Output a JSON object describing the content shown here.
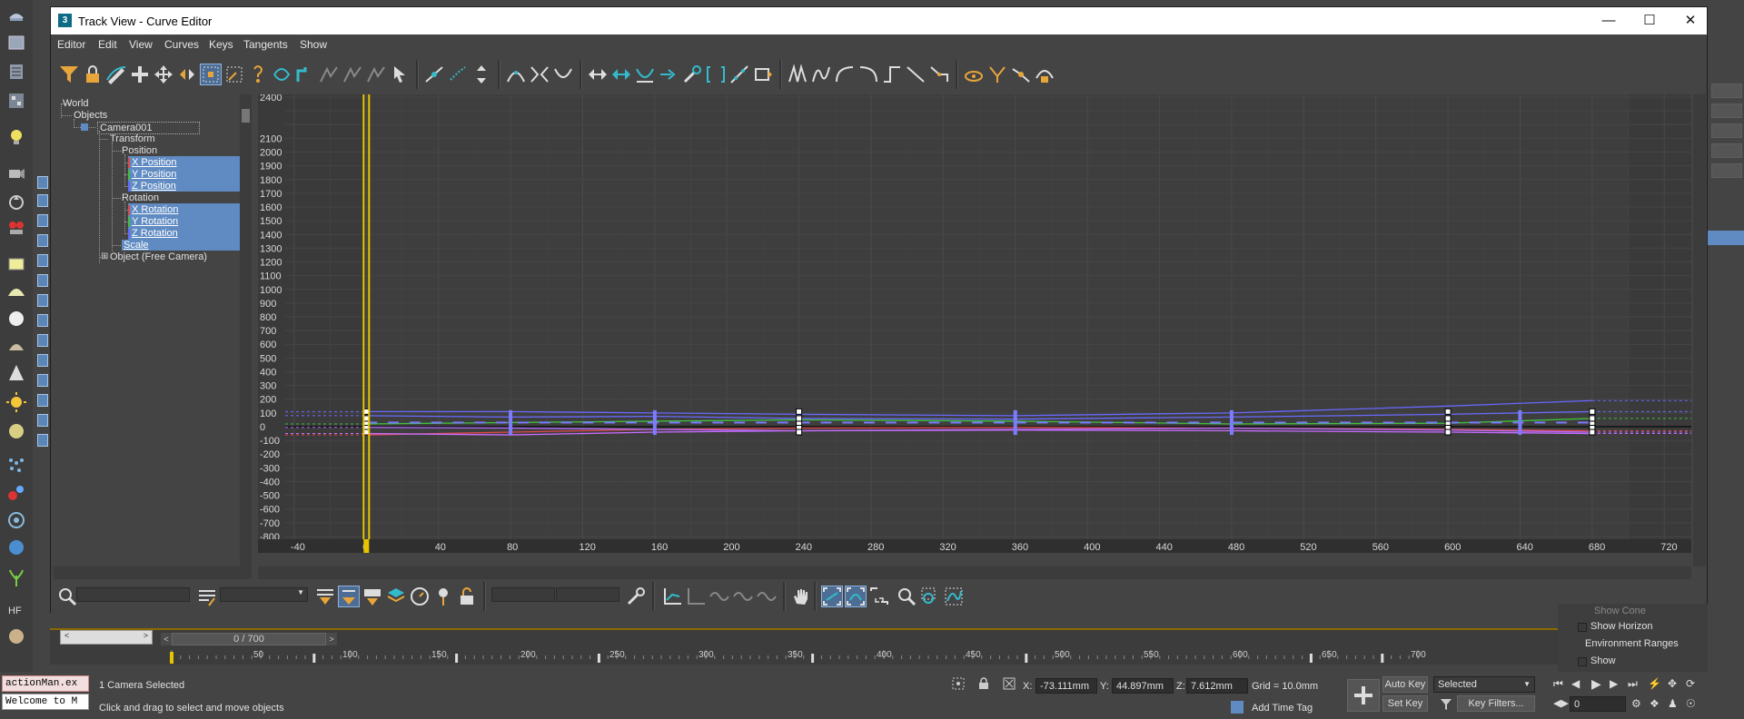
{
  "window": {
    "title": "Track View - Curve Editor",
    "app_icon": "3"
  },
  "menu": [
    "Editor",
    "Edit",
    "View",
    "Curves",
    "Keys",
    "Tangents",
    "Show"
  ],
  "tree": [
    {
      "label": "World",
      "x": 10,
      "y": 4,
      "sel": false
    },
    {
      "label": "Objects",
      "x": 22,
      "y": 17,
      "sel": false
    },
    {
      "label": "Camera001",
      "x": 48,
      "y": 30,
      "sel": false,
      "box": true
    },
    {
      "label": "Transform",
      "x": 62,
      "y": 43,
      "sel": false
    },
    {
      "label": "Position",
      "x": 75,
      "y": 56,
      "sel": false
    },
    {
      "label": "X Position",
      "x": 84,
      "y": 69,
      "sel": true
    },
    {
      "label": "Y Position",
      "x": 84,
      "y": 82,
      "sel": true
    },
    {
      "label": "Z Position",
      "x": 84,
      "y": 95,
      "sel": true
    },
    {
      "label": "Rotation",
      "x": 75,
      "y": 108,
      "sel": false
    },
    {
      "label": "X Rotation",
      "x": 84,
      "y": 121,
      "sel": true
    },
    {
      "label": "Y Rotation",
      "x": 84,
      "y": 134,
      "sel": true
    },
    {
      "label": "Z Rotation",
      "x": 84,
      "y": 147,
      "sel": true
    },
    {
      "label": "Scale",
      "x": 75,
      "y": 160,
      "sel": true
    },
    {
      "label": "Object (Free Camera)",
      "x": 62,
      "y": 173,
      "sel": false,
      "expander": "⊞"
    }
  ],
  "graph": {
    "y_ticks": [
      2400,
      2100,
      2000,
      1900,
      1800,
      1700,
      1600,
      1500,
      1400,
      1300,
      1200,
      1100,
      1000,
      900,
      800,
      700,
      600,
      500,
      400,
      300,
      200,
      100,
      0,
      -100,
      -200,
      -300,
      -400,
      -500,
      -600,
      -700,
      -800
    ],
    "x_ticks": [
      -40,
      0,
      40,
      80,
      120,
      160,
      200,
      240,
      280,
      320,
      360,
      400,
      440,
      480,
      520,
      560,
      600,
      640,
      680,
      720
    ],
    "xlim": [
      -45,
      735
    ],
    "ylim": [
      -820,
      2420
    ],
    "current_frame": 0,
    "keys_blue": [
      80,
      160,
      240,
      360,
      480,
      640,
      680
    ],
    "keys_white": [
      0,
      240,
      600,
      680
    ],
    "curve_colors": {
      "x": "#e04848",
      "y": "#3fbf3f",
      "z": "#6868ff",
      "rot": "#b46cff"
    },
    "curves": [
      {
        "color": "#e04848",
        "points": [
          [
            0,
            -60
          ],
          [
            80,
            -40
          ],
          [
            160,
            -20
          ],
          [
            240,
            -10
          ],
          [
            360,
            -5
          ],
          [
            480,
            -10
          ],
          [
            600,
            -20
          ],
          [
            680,
            -30
          ]
        ],
        "ext": [
          -60,
          -30
        ]
      },
      {
        "color": "#3fbf3f",
        "points": [
          [
            0,
            20
          ],
          [
            80,
            30
          ],
          [
            160,
            40
          ],
          [
            240,
            50
          ],
          [
            360,
            40
          ],
          [
            480,
            20
          ],
          [
            600,
            25
          ],
          [
            680,
            60
          ]
        ],
        "ext": [
          20,
          60
        ]
      },
      {
        "color": "#6868ff",
        "points": [
          [
            0,
            110
          ],
          [
            80,
            110
          ],
          [
            160,
            100
          ],
          [
            240,
            90
          ],
          [
            360,
            80
          ],
          [
            480,
            100
          ],
          [
            600,
            150
          ],
          [
            680,
            190
          ]
        ],
        "ext": [
          110,
          190
        ]
      },
      {
        "color": "#6a6aff",
        "points": [
          [
            0,
            80
          ],
          [
            80,
            70
          ],
          [
            160,
            75
          ],
          [
            240,
            60
          ],
          [
            360,
            55
          ],
          [
            480,
            70
          ],
          [
            600,
            90
          ],
          [
            680,
            110
          ]
        ],
        "ext": [
          80,
          110
        ]
      },
      {
        "color": "#b46cff",
        "points": [
          [
            0,
            -5
          ],
          [
            80,
            -10
          ],
          [
            160,
            -20
          ],
          [
            240,
            -30
          ],
          [
            360,
            -20
          ],
          [
            480,
            -10
          ],
          [
            600,
            -25
          ],
          [
            680,
            -40
          ]
        ],
        "ext": [
          -5,
          -40
        ]
      },
      {
        "color": "#c86cff",
        "points": [
          [
            0,
            -50
          ],
          [
            80,
            -60
          ],
          [
            160,
            -40
          ],
          [
            240,
            -30
          ],
          [
            360,
            -25
          ],
          [
            480,
            -30
          ],
          [
            600,
            -40
          ],
          [
            680,
            -50
          ]
        ],
        "ext": [
          -50,
          -50
        ]
      }
    ]
  },
  "timeline": {
    "slider_label": "0 / 700",
    "ticks": [
      50,
      100,
      150,
      200,
      250,
      300,
      350,
      400,
      450,
      500,
      550,
      600,
      650,
      700
    ],
    "max": 700
  },
  "status": {
    "script_line1": "actionMan.ex",
    "script_line2": "Welcome to M",
    "selection": "1 Camera Selected",
    "prompt": "Click and drag to select and move objects",
    "x_label": "X:",
    "x_value": "-73.111mm",
    "y_label": "Y:",
    "y_value": "44.897mm",
    "z_label": "Z:",
    "z_value": "7.612mm",
    "grid": "Grid = 10.0mm",
    "add_time_tag": "Add Time Tag",
    "auto_key": "Auto Key",
    "set_key": "Set Key",
    "selected_dropdown": "Selected",
    "key_filters": "Key Filters...",
    "frame_value": "0"
  },
  "side_panel": {
    "show_horizon": "Show Horizon",
    "environment_ranges": "Environment Ranges",
    "show": "Show",
    "show_cone": "Show Cone"
  }
}
